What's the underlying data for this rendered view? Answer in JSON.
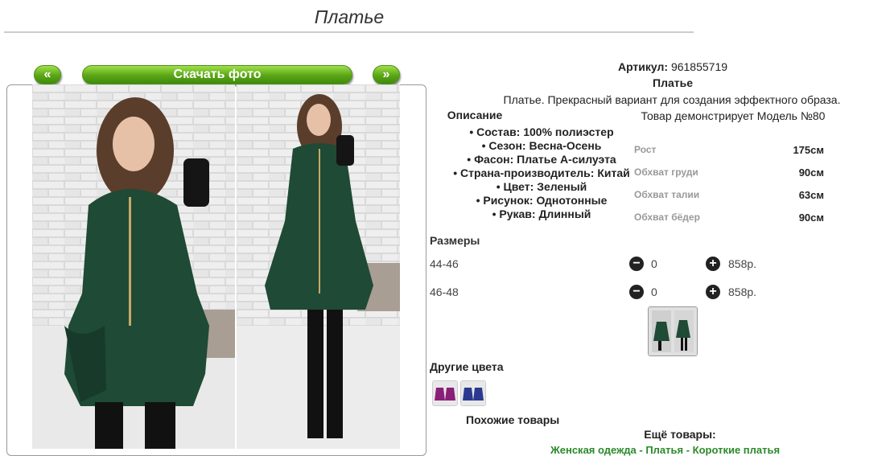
{
  "page": {
    "title": "Платье"
  },
  "gallery": {
    "prev": "«",
    "download": "Скачать фото",
    "next": "»"
  },
  "product": {
    "article_label": "Артикул:",
    "article": "961855719",
    "name": "Платье",
    "description": "Платье. Прекрасный вариант для создания эффектного образа.",
    "description_heading": "Описание",
    "attributes": [
      "Состав: 100% полиэстер",
      "Сезон: Весна-Осень",
      "Фасон: Платье А-силуэта",
      "Страна-производитель: Китай",
      "Цвет: Зеленый",
      "Рисунок: Однотонные",
      "Рукав: Длинный"
    ]
  },
  "model": {
    "caption": "Товар демонстрирует Модель №80",
    "measurements": [
      {
        "label": "Рост",
        "value": "175см"
      },
      {
        "label": "Обхват груди",
        "value": "90см"
      },
      {
        "label": "Обхват талии",
        "value": "63см"
      },
      {
        "label": "Обхват бёдер",
        "value": "90см"
      }
    ]
  },
  "sizes": {
    "heading": "Размеры",
    "rows": [
      {
        "size": "44-46",
        "qty": "0",
        "price": "858р."
      },
      {
        "size": "46-48",
        "qty": "0",
        "price": "858р."
      }
    ],
    "minus": "−",
    "plus": "+"
  },
  "other_colors": {
    "heading": "Другие цвета"
  },
  "similar": {
    "heading": "Похожие товары"
  },
  "more": {
    "heading": "Ещё товары:",
    "links": "Женская одежда - Платья - Короткие платья"
  },
  "colors": {
    "accent": "#5aa516",
    "dress": "#1f4a35",
    "link": "#2a8a2a"
  }
}
